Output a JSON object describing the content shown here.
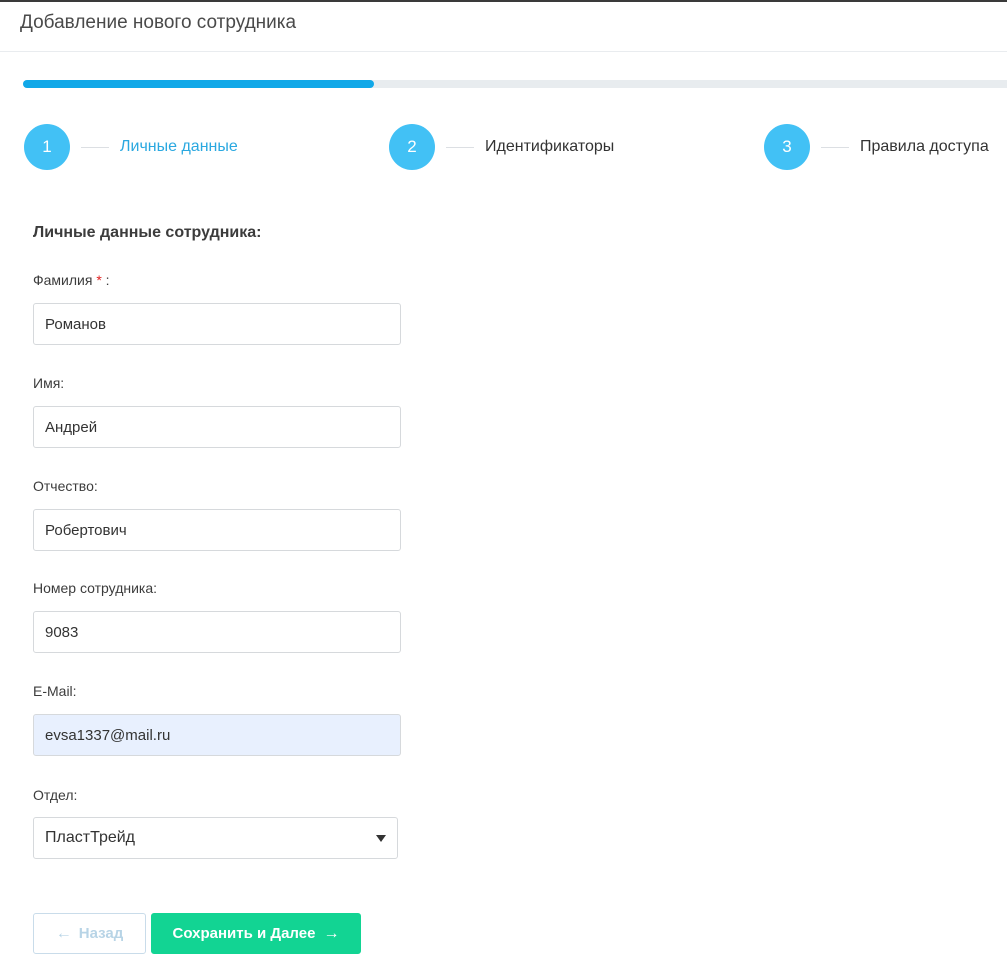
{
  "header": {
    "title": "Добавление нового сотрудника"
  },
  "progress": {
    "fraction": 0.357,
    "color": "#11a8e8"
  },
  "steps": [
    {
      "number": "1",
      "label": "Личные данные",
      "active": true
    },
    {
      "number": "2",
      "label": "Идентификаторы",
      "active": false
    },
    {
      "number": "3",
      "label": "Правила доступа",
      "active": false
    }
  ],
  "form": {
    "section_title": "Личные данные сотрудника:",
    "last_name": {
      "label": "Фамилия",
      "required_mark": "*",
      "label_suffix": " :",
      "value": "Романов"
    },
    "first_name": {
      "label": "Имя:",
      "value": "Андрей"
    },
    "middle_name": {
      "label": "Отчество:",
      "value": "Робертович"
    },
    "employee_number": {
      "label": "Номер сотрудника:",
      "value": "9083"
    },
    "email": {
      "label": "E-Mail:",
      "value": "evsa1337@mail.ru"
    },
    "department": {
      "label": "Отдел:",
      "selected": "ПластТрейд"
    }
  },
  "buttons": {
    "back_label": "Назад",
    "back_arrow": "←",
    "next_label": "Сохранить и Далее",
    "next_arrow": "→"
  },
  "colors": {
    "accent": "#42c1f5",
    "active_step_text": "#2aa8e0",
    "primary_button": "#12d493",
    "required": "#e02020"
  }
}
